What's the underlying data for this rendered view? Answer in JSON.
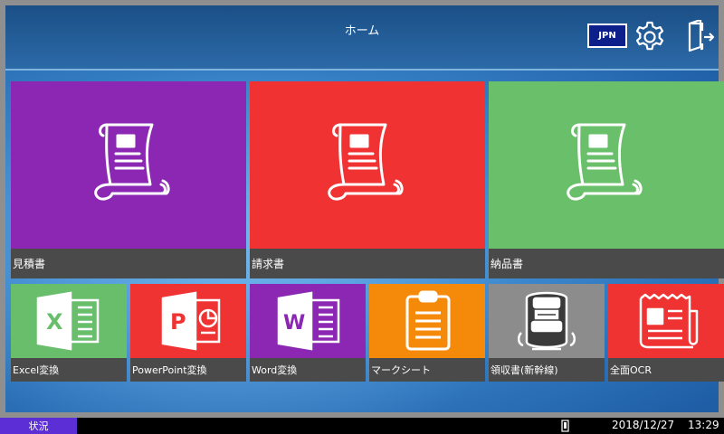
{
  "header": {
    "title": "ホーム",
    "language": "JPN",
    "settings_icon": "gear-icon",
    "logout_icon": "logout-icon"
  },
  "tiles_large": [
    {
      "label": "見積書",
      "color": "#8b27b2",
      "icon": "document-scroll-icon"
    },
    {
      "label": "請求書",
      "color": "#f03233",
      "icon": "document-scroll-icon"
    },
    {
      "label": "納品書",
      "color": "#6abf6a",
      "icon": "document-scroll-icon"
    }
  ],
  "tiles_small": [
    {
      "label": "Excel変換",
      "color": "#68be6a",
      "icon": "excel-icon"
    },
    {
      "label": "PowerPoint変換",
      "color": "#ef3232",
      "icon": "powerpoint-icon"
    },
    {
      "label": "Word変換",
      "color": "#8b27b2",
      "icon": "word-icon"
    },
    {
      "label": "マークシート",
      "color": "#f5890a",
      "icon": "clipboard-icon"
    },
    {
      "label": "領収書(新幹線)",
      "color": "#8c8c8c",
      "icon": "train-icon"
    },
    {
      "label": "全面OCR",
      "color": "#ef3232",
      "icon": "newspaper-icon"
    }
  ],
  "statusbar": {
    "status_label": "状況",
    "date": "2018/12/27",
    "time": "13:29"
  }
}
